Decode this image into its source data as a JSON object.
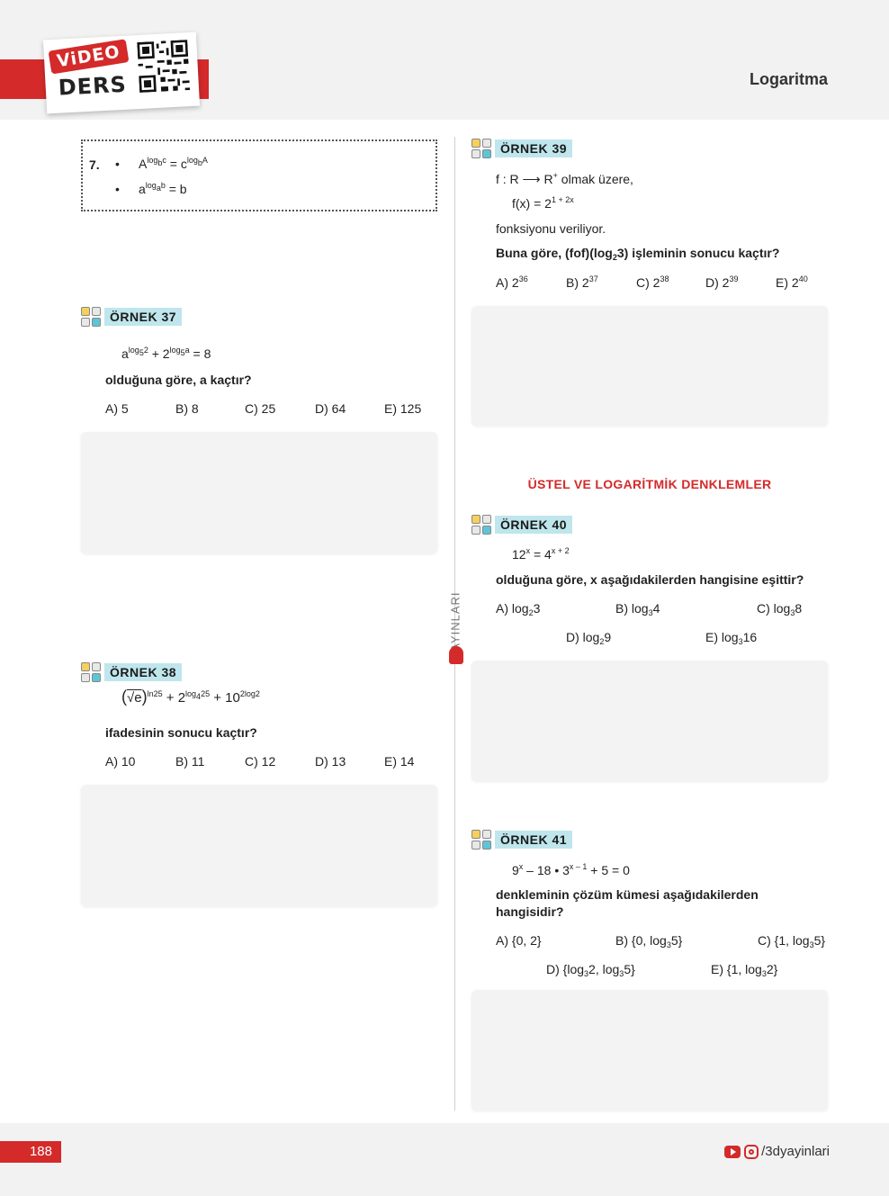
{
  "header": {
    "badge_video": "ViDEO",
    "badge_ders": "DERS",
    "title": "Logaritma"
  },
  "sidebar": {
    "publisher": "YAYINLARI"
  },
  "item7": {
    "number": "7.",
    "bullet": "•",
    "rule1": {
      "a": "A",
      "sup_log": "log",
      "sup_b": "b",
      "sup_c": "c",
      "eq": " = c",
      "sup2_log": "log",
      "sup2_b": "b",
      "sup2_A": "A"
    },
    "rule2": {
      "a": "a",
      "sup_log": "log",
      "sup_a": "a",
      "sup_b": "b",
      "eq": " = b"
    }
  },
  "ornek37": {
    "label": "ÖRNEK 37",
    "eq": {
      "a": "a",
      "log": "log",
      "base": "5",
      "exp": "2",
      "plus": " + 2",
      "log2": "log",
      "base2": "5",
      "exp2": "a",
      "rhs": " = 8"
    },
    "question": "olduğuna göre, a kaçtır?",
    "choices": [
      "A) 5",
      "B) 8",
      "C) 25",
      "D) 64",
      "E) 125"
    ]
  },
  "ornek38": {
    "label": "ÖRNEK 38",
    "eq": {
      "open": "(",
      "root": "√e",
      "close": ")",
      "exp1": "ln25",
      "plus1": " + 2",
      "exp2": "log",
      "sub2": "4",
      "exp2b": "25",
      "plus2": " + 10",
      "exp3": "2log2"
    },
    "question": "ifadesinin sonucu kaçtır?",
    "choices": [
      "A) 10",
      "B) 11",
      "C) 12",
      "D) 13",
      "E) 14"
    ]
  },
  "ornek39": {
    "label": "ÖRNEK 39",
    "line1_a": "f : R ⟶ R",
    "line1_sup": "+",
    "line1_b": " olmak üzere,",
    "line2_a": "f(x) = 2",
    "line2_sup": "1 + 2x",
    "line3": "fonksiyonu veriliyor.",
    "q_a": "Buna göre, (fof)(log",
    "q_sub": "2",
    "q_b": "3) işleminin sonucu kaçtır?",
    "choices": [
      {
        "p": "A) 2",
        "e": "36"
      },
      {
        "p": "B) 2",
        "e": "37"
      },
      {
        "p": "C) 2",
        "e": "38"
      },
      {
        "p": "D) 2",
        "e": "39"
      },
      {
        "p": "E) 2",
        "e": "40"
      }
    ]
  },
  "section": {
    "title": "ÜSTEL VE LOGARİTMİK DENKLEMLER"
  },
  "ornek40": {
    "label": "ÖRNEK 40",
    "eq_a": "12",
    "eq_sup1": "x",
    "eq_b": " = 4",
    "eq_sup2": "x + 2",
    "question": "olduğuna göre, x aşağıdakilerden hangisine eşittir?",
    "choices": [
      {
        "p": "A) log",
        "s": "2",
        "a": "3"
      },
      {
        "p": "B) log",
        "s": "3",
        "a": "4"
      },
      {
        "p": "C) log",
        "s": "3",
        "a": "8"
      },
      {
        "p": "D) log",
        "s": "2",
        "a": "9"
      },
      {
        "p": "E) log",
        "s": "3",
        "a": "16"
      }
    ]
  },
  "ornek41": {
    "label": "ÖRNEK 41",
    "eq_a": "9",
    "eq_sup1": "x",
    "eq_b": " – 18 • 3",
    "eq_sup2": "x – 1",
    "eq_c": " + 5 = 0",
    "question_l1": "denkleminin çözüm kümesi aşağıdakilerden",
    "question_l2": "hangisidir?",
    "choiceA": "A) {0, 2}",
    "choiceB": {
      "p": "B) {0, log",
      "s": "3",
      "a": "5}"
    },
    "choiceC": {
      "p": "C) {1, log",
      "s": "3",
      "a": "5}"
    },
    "choiceD": {
      "p": "D) {log",
      "s": "3",
      "m": "2, log",
      "s2": "3",
      "a": "5}"
    },
    "choiceE": {
      "p": "E) {1, log",
      "s": "3",
      "a": "2}"
    }
  },
  "footer": {
    "page": "188",
    "social": "/3dyayinlari"
  }
}
